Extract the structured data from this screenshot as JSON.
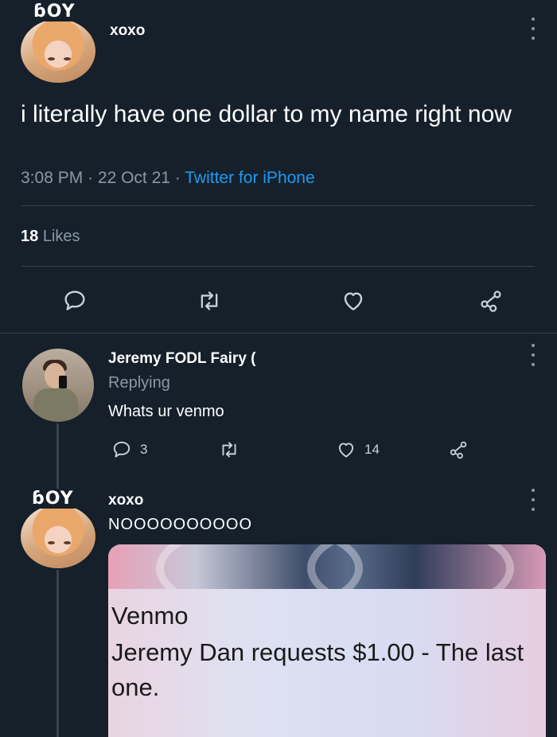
{
  "main_tweet": {
    "badge": "ɓOY",
    "author": "xoxo",
    "text": "i literally have one dollar to my name right now",
    "time": "3:08 PM",
    "date": "22 Oct 21",
    "source": "Twitter for iPhone",
    "likes_count": "18",
    "likes_label": "Likes"
  },
  "reply1": {
    "author": "Jeremy FODL Fairy (",
    "replying": "Replying",
    "text": "Whats ur venmo",
    "reply_count": "3",
    "like_count": "14"
  },
  "reply2": {
    "badge": "ɓOY",
    "author": "xoxo",
    "text": "NOOOOOOOOOO",
    "card": {
      "title": "Venmo",
      "text": "Jeremy Dan requests $1.00 - The last one."
    }
  },
  "colors": {
    "background": "#15202b",
    "link": "#1d9bf0",
    "muted": "#8899a6",
    "divider": "#38444d"
  },
  "icons": [
    "more-icon",
    "reply-icon",
    "retweet-icon",
    "like-icon",
    "share-icon"
  ]
}
